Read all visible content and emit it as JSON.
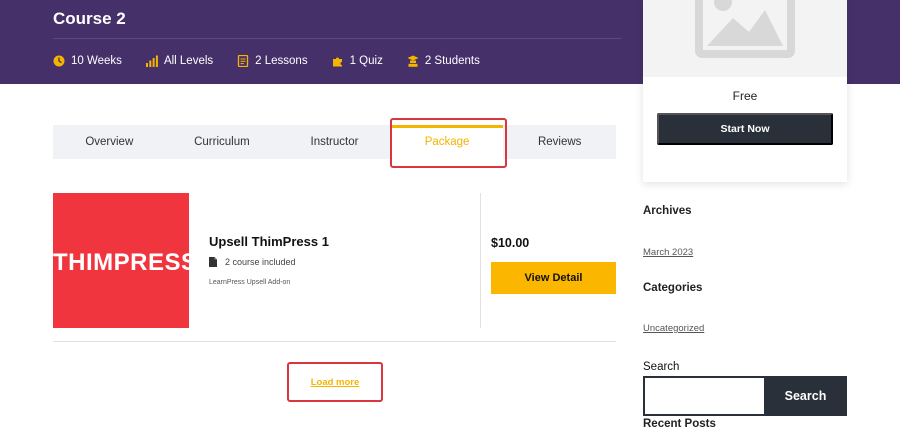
{
  "course": {
    "title": "Course 2",
    "meta": [
      {
        "icon": "clock-icon",
        "label": "10 Weeks"
      },
      {
        "icon": "level-bars-icon",
        "label": "All Levels"
      },
      {
        "icon": "lessons-file-icon",
        "label": "2 Lessons"
      },
      {
        "icon": "puzzle-icon",
        "label": "1 Quiz"
      },
      {
        "icon": "students-icon",
        "label": "2 Students"
      }
    ]
  },
  "tabs": [
    {
      "label": "Overview",
      "active": false
    },
    {
      "label": "Curriculum",
      "active": false
    },
    {
      "label": "Instructor",
      "active": false
    },
    {
      "label": "Package",
      "active": true
    },
    {
      "label": "Reviews",
      "active": false
    }
  ],
  "package": {
    "thumb_text": "THIMPRESS",
    "name": "Upsell ThimPress 1",
    "course_count": "2 course included",
    "addon": "LearnPress Upsell Add-on",
    "price": "$10.00",
    "view_label": "View Detail"
  },
  "load_more": "Load more",
  "sidebar": {
    "price": "Free",
    "start_label": "Start Now",
    "archives_title": "Archives",
    "archives_link": "March 2023",
    "categories_title": "Categories",
    "categories_link": "Uncategorized",
    "search_title": "Search",
    "search_placeholder": "",
    "search_button": "Search",
    "recent_title": "Recent Posts"
  },
  "colors": {
    "hero": "#46306a",
    "accent": "#f5b400",
    "button_dark": "#293039",
    "thumb_red": "#f0353f",
    "highlight": "#d9363e"
  }
}
